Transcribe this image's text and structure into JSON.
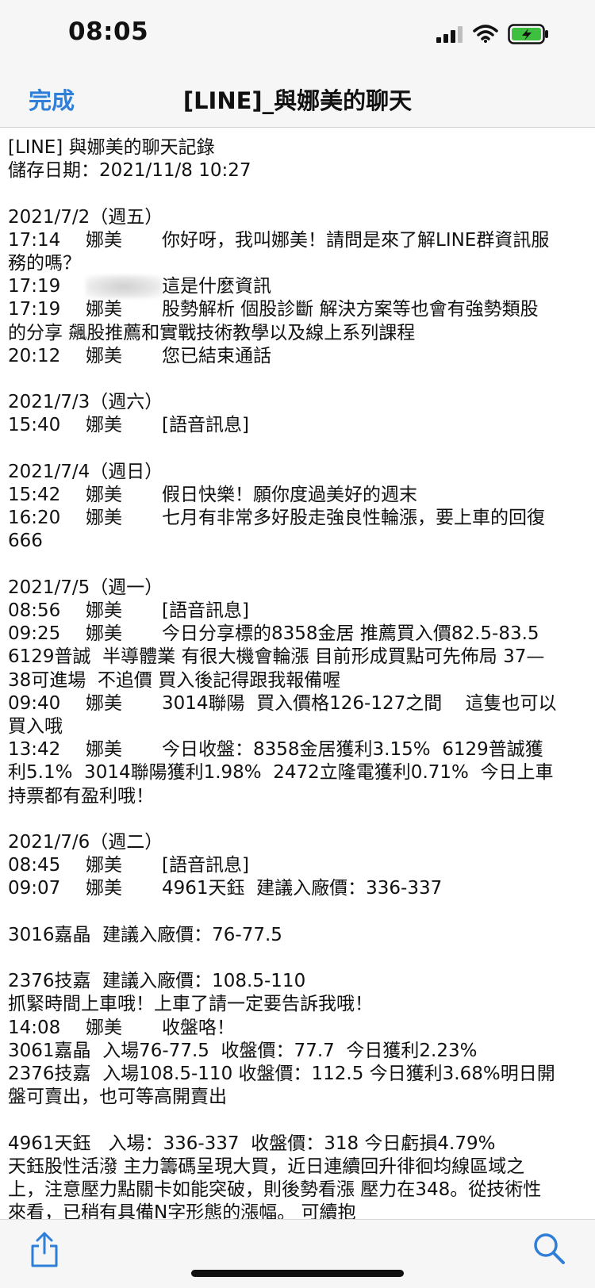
{
  "status_bar": {
    "time": "08:05",
    "icons": [
      "signal-icon",
      "wifi-icon",
      "battery-charging-icon"
    ]
  },
  "nav": {
    "done_label": "完成",
    "title": "[LINE]_與娜美的聊天"
  },
  "header_lines": [
    "[LINE] 與娜美的聊天記錄",
    "儲存日期：2021/11/8 10:27"
  ],
  "sections": [
    {
      "date": "2021/7/2（週五）",
      "items": [
        {
          "time": "17:14",
          "sender": "娜美",
          "text": "你好呀，我叫娜美！請問是來了解LINE群資訊服",
          "cont": [
            "務的嗎？"
          ]
        },
        {
          "time": "17:19",
          "sender": "",
          "text": "這是什麼資訊",
          "cont": [],
          "blurred_sender": true
        },
        {
          "time": "17:19",
          "sender": "娜美",
          "text": "股勢解析 個股診斷 解決方案等也會有強勢類股",
          "cont": [
            "的分享 飆股推薦和實戰技術教學以及線上系列課程"
          ]
        },
        {
          "time": "20:12",
          "sender": "娜美",
          "text": "您已結束通話",
          "cont": []
        }
      ]
    },
    {
      "date": "2021/7/3（週六）",
      "items": [
        {
          "time": "15:40",
          "sender": "娜美",
          "text": "[語音訊息]",
          "cont": []
        }
      ]
    },
    {
      "date": "2021/7/4（週日）",
      "items": [
        {
          "time": "15:42",
          "sender": "娜美",
          "text": "假日快樂！願你度過美好的週末",
          "cont": []
        },
        {
          "time": "16:20",
          "sender": "娜美",
          "text": "七月有非常多好股走強良性輪漲，要上車的回復",
          "cont": [
            "666"
          ]
        }
      ]
    },
    {
      "date": "2021/7/5（週一）",
      "items": [
        {
          "time": "08:56",
          "sender": "娜美",
          "text": "[語音訊息]",
          "cont": []
        },
        {
          "time": "09:25",
          "sender": "娜美",
          "text": "今日分享標的8358金居 推薦買入價82.5-83.5",
          "cont": [
            "6129普誠  半導體業 有很大機會輪漲 目前形成買點可先佈局 37—",
            "38可進場  不追價 買入後記得跟我報備喔"
          ]
        },
        {
          "time": "09:40",
          "sender": "娜美",
          "text": "3014聯陽  買入價格126-127之間    這隻也可以",
          "cont": [
            "買入哦"
          ]
        },
        {
          "time": "13:42",
          "sender": "娜美",
          "text": "今日收盤：8358金居獲利3.15%  6129普誠獲",
          "cont": [
            "利5.1%  3014聯陽獲利1.98%  2472立隆電獲利0.71%  今日上車",
            "持票都有盈利哦！"
          ]
        }
      ]
    },
    {
      "date": "2021/7/6（週二）",
      "items": [
        {
          "time": "08:45",
          "sender": "娜美",
          "text": "[語音訊息]",
          "cont": []
        },
        {
          "time": "09:07",
          "sender": "娜美",
          "text": "4961天鈺  建議入廠價：336-337",
          "cont": [
            "",
            "3016嘉晶  建議入廠價：76-77.5",
            "",
            "2376技嘉  建議入廠價：108.5-110",
            "抓緊時間上車哦！上車了請一定要告訴我哦！"
          ]
        },
        {
          "time": "14:08",
          "sender": "娜美",
          "text": "收盤咯！",
          "cont": [
            "3061嘉晶  入場76-77.5  收盤價：77.7  今日獲利2.23%",
            "2376技嘉  入場108.5-110 收盤價：112.5 今日獲利3.68%明日開",
            "盤可賣出，也可等高開賣出",
            "",
            "4961天鈺   入場：336-337  收盤價：318 今日虧損4.79%",
            "天鈺股性活潑 主力籌碼呈現大買，近日連續回升徘徊均線區域之",
            "上，注意壓力點關卡如能突破，則後勢看漲 壓力在348。從技術性",
            "來看，已稍有具備N字形態的漲幅。 可續抱"
          ]
        }
      ]
    }
  ],
  "toolbar": {
    "share_icon": "share-icon",
    "search_icon": "search-icon"
  }
}
